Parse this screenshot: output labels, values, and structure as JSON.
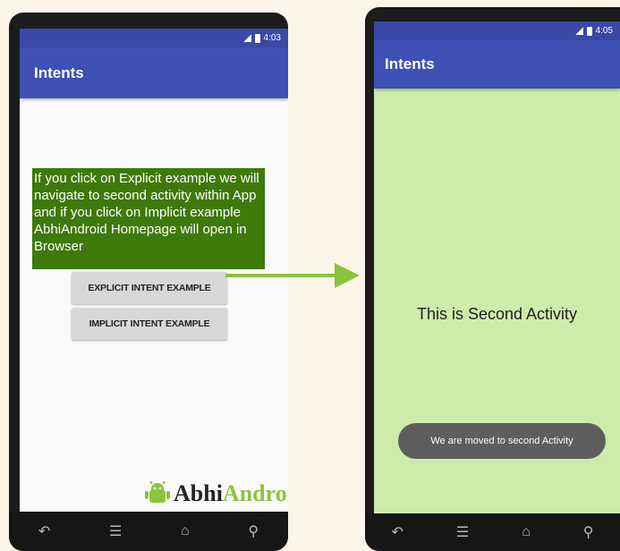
{
  "left_phone": {
    "status_time": "4:03",
    "app_title": "Intents",
    "description": "If you click on Explicit example we will navigate to second activity within App and if you click on Implicit example AbhiAndroid Homepage will open in Browser",
    "buttons": {
      "explicit": "EXPLICIT INTENT EXAMPLE",
      "implicit": "IMPLICIT INTENT EXAMPLE"
    },
    "logo": {
      "part1": "Abhi",
      "part2": "Android"
    }
  },
  "right_phone": {
    "status_time": "4:05",
    "app_title": "Intents",
    "main_text": "This is Second Activity",
    "toast": "We are moved to second Activity"
  },
  "nav_icons": [
    "back-icon",
    "menu-icon",
    "home-icon",
    "search-icon"
  ],
  "colors": {
    "app_bar": "#3f51b5",
    "description_bg": "#3d7a0a",
    "second_bg": "#cdecac",
    "arrow": "#8bc43f"
  }
}
